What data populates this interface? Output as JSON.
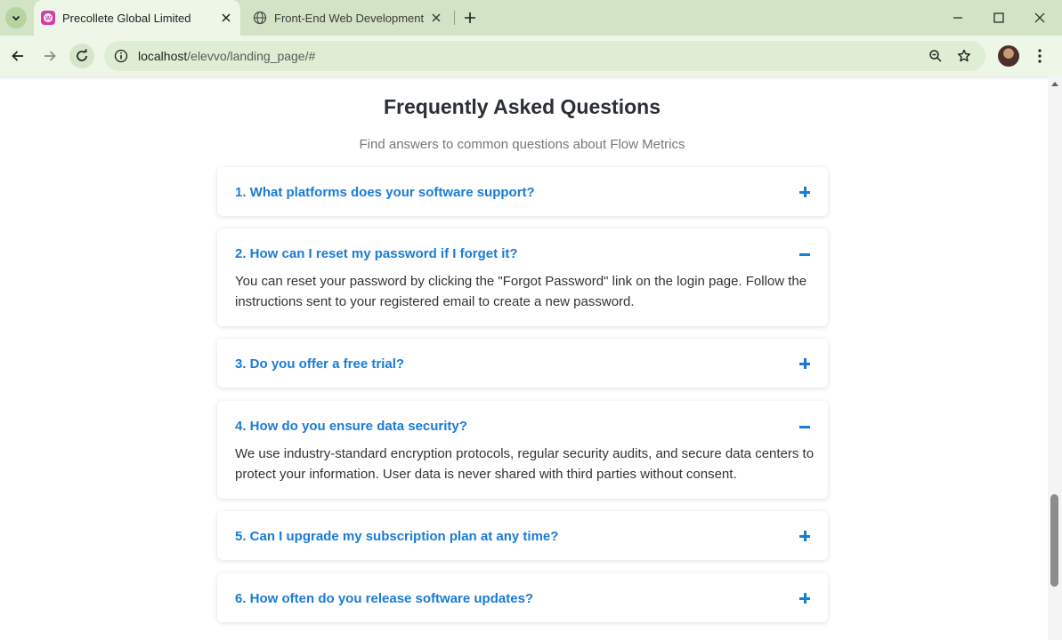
{
  "browser": {
    "tabs": [
      {
        "title": "Precollete Global Limited",
        "active": true
      },
      {
        "title": "Front-End Web Development Ta",
        "active": false
      }
    ],
    "url_host": "localhost",
    "url_path": "/elevvo/landing_page/#",
    "colors": {
      "tabstrip": "#d3e3c5",
      "toolbar": "#eef6e8",
      "favicon": "#d63aa8"
    }
  },
  "page": {
    "faq": {
      "title": "Frequently Asked Questions",
      "subtitle": "Find answers to common questions about Flow Metrics",
      "accent": "#1a7bd6",
      "items": [
        {
          "question": "1. What platforms does your software support?",
          "expanded": false,
          "answer": ""
        },
        {
          "question": "2. How can I reset my password if I forget it?",
          "expanded": true,
          "answer": "You can reset your password by clicking the \"Forgot Password\" link on the login page. Follow the instructions sent to your registered email to create a new password."
        },
        {
          "question": "3. Do you offer a free trial?",
          "expanded": false,
          "answer": ""
        },
        {
          "question": "4. How do you ensure data security?",
          "expanded": true,
          "answer": "We use industry-standard encryption protocols, regular security audits, and secure data centers to protect your information. User data is never shared with third parties without consent."
        },
        {
          "question": "5. Can I upgrade my subscription plan at any time?",
          "expanded": false,
          "answer": ""
        },
        {
          "question": "6. How often do you release software updates?",
          "expanded": false,
          "answer": ""
        }
      ]
    }
  }
}
